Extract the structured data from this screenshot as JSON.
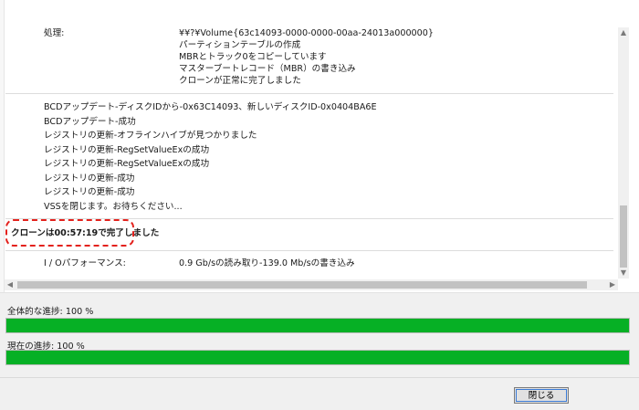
{
  "log": {
    "process_label": "処理:",
    "process_lines": [
      "¥¥?¥Volume{63c14093-0000-0000-00aa-24013a000000}",
      "パーティションテーブルの作成",
      "MBRとトラック0をコピーしています",
      "マスターブートレコード（MBR）の書き込み",
      "クローンが正常に完了しました"
    ],
    "detail_lines": [
      "BCDアップデート-ディスクIDから-0x63C14093、新しいディスクID-0x0404BA6E",
      "BCDアップデート-成功",
      "レジストリの更新-オフラインハイブが見つかりました",
      "レジストリの更新-RegSetValueExの成功",
      "レジストリの更新-RegSetValueExの成功",
      "レジストリの更新-成功",
      "レジストリの更新-成功",
      "VSSを閉じます。お待ちください..."
    ],
    "completion_message": "クローンは00:57:19で完了しました",
    "io_label": "I / Oパフォーマンス:",
    "io_value": "0.9 Gb/sの読み取り-139.0 Mb/sの書き込み"
  },
  "progress": {
    "overall_label": "全体的な進捗:",
    "overall_percent_text": "100 %",
    "overall_value": 1.0,
    "current_label": "現在の進捗:",
    "current_percent_text": "100 %",
    "current_value": 1.0,
    "fill_color": "#06b025"
  },
  "footer": {
    "close_label": "閉じる"
  },
  "colors": {
    "highlight_border": "#e3211c"
  }
}
